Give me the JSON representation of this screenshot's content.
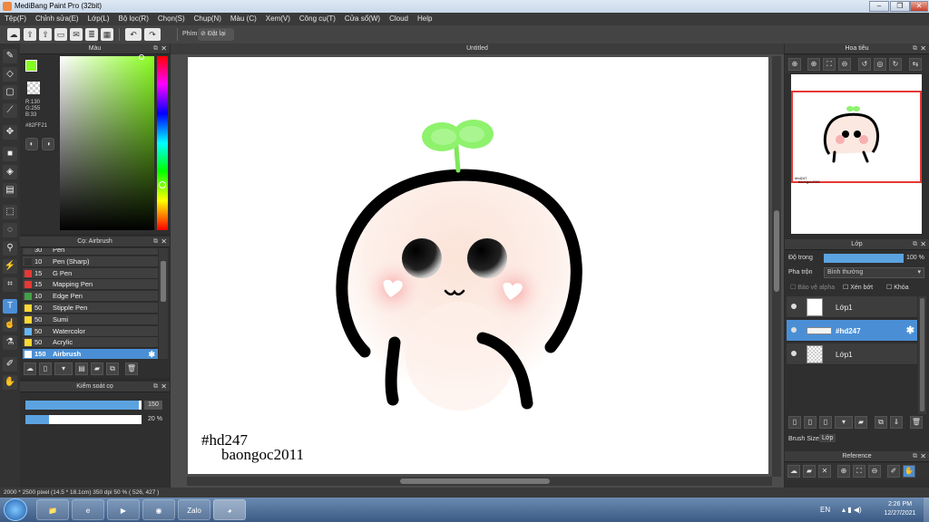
{
  "window": {
    "title": "MediBang Paint Pro (32bit)"
  },
  "menu": [
    "Tệp(F)",
    "Chỉnh sửa(E)",
    "Lớp(L)",
    "Bộ lọc(R)",
    "Chọn(S)",
    "Chụp(N)",
    "Màu (C)",
    "Xem(V)",
    "Công cụ(T)",
    "Cửa sổ(W)",
    "Cloud",
    "Help"
  ],
  "toolbar": {
    "key_label": "Phím",
    "reset_label": "Đặt lại"
  },
  "color_panel": {
    "title": "Màu",
    "r": "R:130",
    "g": "G:255",
    "b": "B:33",
    "hex": "#82FF21",
    "current_color": "#82ff21"
  },
  "brush_panel": {
    "title": "Cọ: Airbrush",
    "items": [
      {
        "size": "30",
        "name": "Pen",
        "color": "#444444"
      },
      {
        "size": "10",
        "name": "Pen (Sharp)",
        "color": "#333333"
      },
      {
        "size": "15",
        "name": "G Pen",
        "color": "#e53935"
      },
      {
        "size": "15",
        "name": "Mapping Pen",
        "color": "#e53935"
      },
      {
        "size": "10",
        "name": "Edge Pen",
        "color": "#43a047"
      },
      {
        "size": "50",
        "name": "Stipple Pen",
        "color": "#fdd835"
      },
      {
        "size": "50",
        "name": "Sumi",
        "color": "#fdd835"
      },
      {
        "size": "50",
        "name": "Watercolor",
        "color": "#64b5f6"
      },
      {
        "size": "50",
        "name": "Acrylic",
        "color": "#fdd835"
      },
      {
        "size": "150",
        "name": "Airbrush",
        "color": "#ffffff"
      }
    ]
  },
  "brush_control": {
    "title": "Kiểm soát cọ",
    "size_value": "150",
    "opacity_value": "20 %",
    "size_fraction": 0.98,
    "opacity_fraction": 0.2
  },
  "canvas": {
    "tab_title": "Untitled",
    "text_line1": "#hd247",
    "text_line2": "baongoc2011"
  },
  "navigator": {
    "title": "Hoa tiêu",
    "thumb_text1": "#hd247",
    "thumb_text2": "baongoc2011"
  },
  "layers": {
    "title": "Lớp",
    "opacity_label": "Độ trong",
    "opacity_value": "100 %",
    "opacity_fraction": 1.0,
    "blend_label": "Pha trộn",
    "blend_value": "Bình thường",
    "protect_alpha": "Bảo vệ alpha",
    "clip": "Xén bớt",
    "lock": "Khóa",
    "items": [
      {
        "name": "Lớp1"
      },
      {
        "name": "#hd247"
      },
      {
        "name": "Lớp1"
      }
    ],
    "tab_brush_size": "Brush Size",
    "tab_layer": "Lớp"
  },
  "reference": {
    "title": "Reference"
  },
  "status": {
    "text": "2000 * 2500 pixel   (14.5 * 18.1cm)   350 dpi   50 %   ( 526, 427 )"
  },
  "taskbar": {
    "lang": "EN",
    "time": "2:26 PM",
    "date": "12/27/2021"
  }
}
